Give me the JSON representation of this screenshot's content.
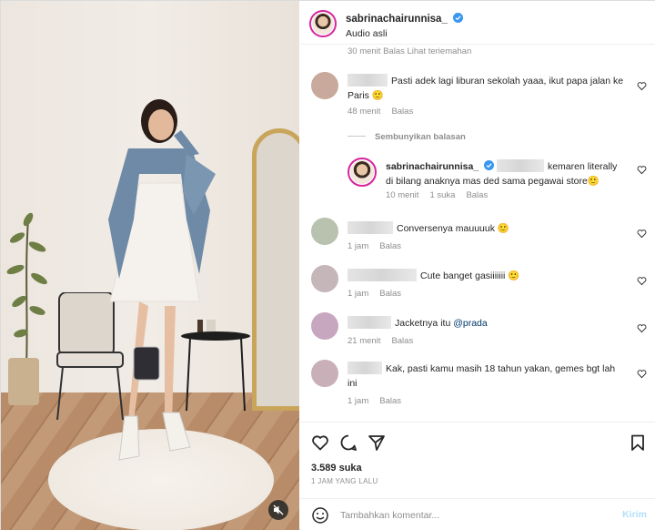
{
  "header": {
    "username": "sabrinachairunnisa_",
    "audio": "Audio asli"
  },
  "comments_cut_text": "30 menit   Balas   Lihat terjemahan",
  "comments": [
    {
      "id": "c1",
      "text": "Pasti adek lagi liburan sekolah yaaa, ikut papa jalan ke Paris 🙂",
      "time": "48 menit",
      "reply": "Balas"
    },
    {
      "id": "c2",
      "text": "Conversenya mauuuuk 🙂",
      "time": "1 jam",
      "reply": "Balas"
    },
    {
      "id": "c3",
      "text": "Cute banget gasiiiiiii 🙂",
      "time": "1 jam",
      "reply": "Balas"
    },
    {
      "id": "c4",
      "text_prefix": "Jacketnya itu ",
      "mention": "@prada",
      "time": "21 menit",
      "reply": "Balas"
    },
    {
      "id": "c5",
      "text": "Kak, pasti kamu masih 18 tahun yakan, gemes bgt lah ini",
      "time": "1 jam",
      "reply": "Balas"
    }
  ],
  "hide_replies": "Sembunyikan balasan",
  "reply": {
    "username": "sabrinachairunnisa_",
    "text": "kemaren literally di bilang anaknya mas ded sama pegawai store🙂",
    "time": "10 menit",
    "likes": "1 suka",
    "reply_label": "Balas"
  },
  "footer": {
    "likes": "3.589 suka",
    "time_ago": "1 JAM YANG LALU",
    "comment_placeholder": "Tambahkan komentar...",
    "send_label": "Kirim"
  },
  "colors": {
    "verified": "#3897f0",
    "text": "#262626",
    "muted": "#8e8e8e",
    "send_disabled": "#b2dffc"
  }
}
